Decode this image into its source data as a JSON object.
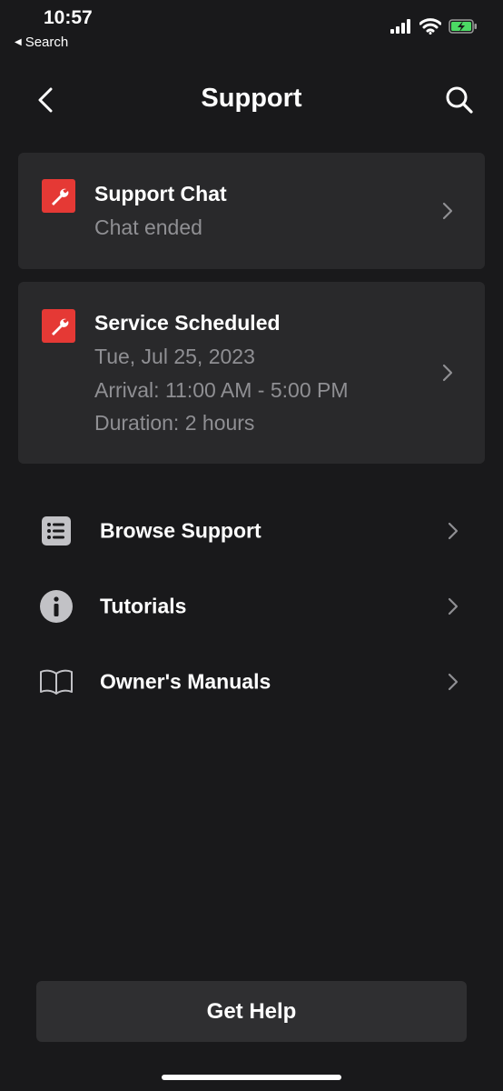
{
  "status_bar": {
    "time": "10:57",
    "back_app": "Search",
    "battery_color": "#4cd964"
  },
  "header": {
    "title": "Support",
    "back_icon": "chevron-left-icon",
    "search_icon": "search-icon"
  },
  "cards": {
    "support_chat": {
      "title": "Support Chat",
      "subtitle": "Chat ended",
      "icon": "wrench-icon"
    },
    "service": {
      "title": "Service Scheduled",
      "date": "Tue, Jul 25, 2023",
      "arrival": "Arrival: 11:00 AM - 5:00 PM",
      "duration": "Duration: 2 hours",
      "icon": "wrench-icon"
    }
  },
  "menu": {
    "items": [
      {
        "label": "Browse Support",
        "icon": "list-icon"
      },
      {
        "label": "Tutorials",
        "icon": "info-icon"
      },
      {
        "label": "Owner's Manuals",
        "icon": "book-icon"
      }
    ]
  },
  "actions": {
    "get_help_label": "Get Help"
  },
  "colors": {
    "background": "#19191b",
    "card": "#29292b",
    "accent_red": "#e53935",
    "muted_text": "#8f8f93"
  }
}
